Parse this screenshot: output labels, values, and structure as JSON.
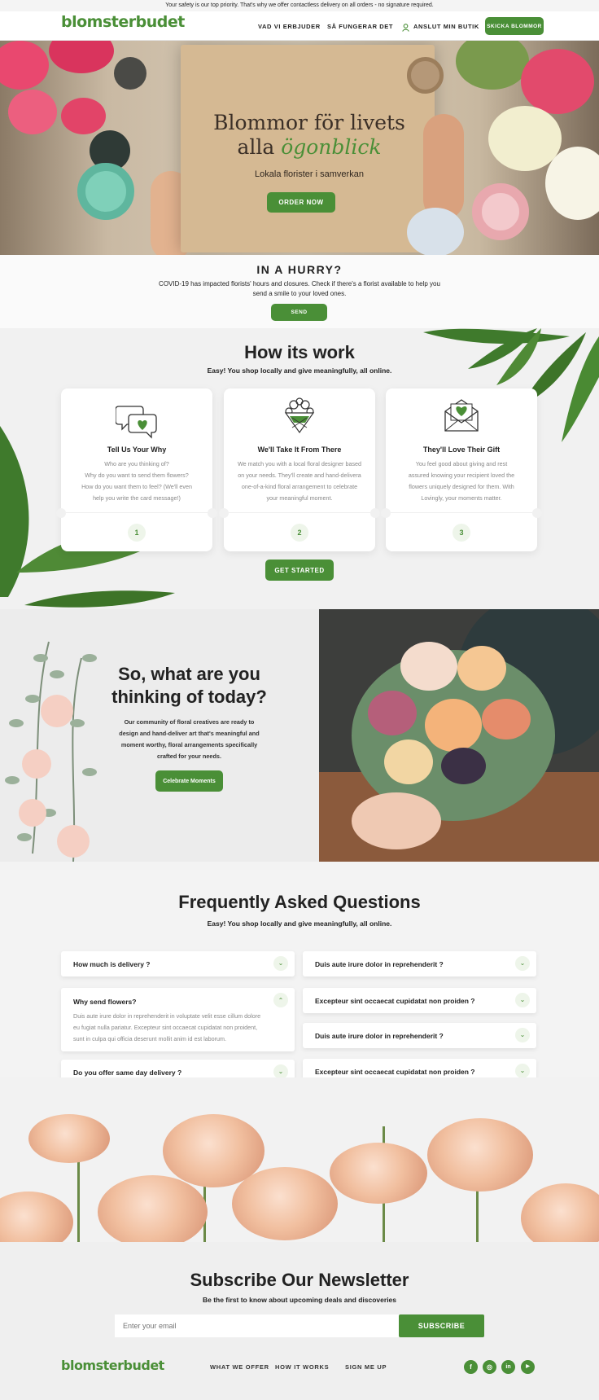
{
  "topbar": {
    "text": "Your safety is our top priority. That's why we offer contactless delivery on all orders - no signature required."
  },
  "header": {
    "logo": "blomsterbudet",
    "nav": [
      "VAD VI ERBJUDER",
      "SÅ FUNGERAR DET"
    ],
    "account": "ANSLUT MIN BUTIK",
    "cta": "SKICKA BLOMMOR"
  },
  "hero": {
    "title_line1": "Blommor för livets",
    "title_line2_a": "alla",
    "title_line2_b": "ögonblick",
    "subtitle": "Lokala florister i samverkan",
    "button": "ORDER NOW"
  },
  "hurry": {
    "title": "IN A HURRY?",
    "text_line1": "COVID-19 has impacted florists' hours and closures. Check if there's a florist available to help you",
    "text_line2": "send a smile to your loved ones.",
    "button": "SEND"
  },
  "how": {
    "title": "How its work",
    "subtitle": "Easy! You shop locally and give meaningfully, all online.",
    "cards": [
      {
        "icon": "chat-heart-icon",
        "title": "Tell Us Your Why",
        "lines": [
          "Who are you thinking of?",
          "Why do you want to send them flowers?",
          "How do you want them to feel? (We'll even",
          "help you write the card message!)"
        ],
        "number": "1"
      },
      {
        "icon": "bouquet-icon",
        "title": "We'll Take It From There",
        "lines": [
          "We match you with a local floral designer based",
          "on your needs. They'll create and hand-delivera",
          "one-of-a-kind floral arrangement to celebrate",
          "your meaningful moment."
        ],
        "number": "2"
      },
      {
        "icon": "envelope-heart-icon",
        "title": "They'll Love Their Gift",
        "lines": [
          "You feel good about giving and rest",
          "assured knowing your recipient loved the",
          "flowers uniquely designed for them. With",
          "Lovingly, your moments matter."
        ],
        "number": "3"
      }
    ],
    "button": "GET STARTED"
  },
  "think": {
    "title_line1": "So, what are you",
    "title_line2": "thinking of today?",
    "lines": [
      "Our community of floral creatives are ready to",
      "design and hand-deliver art that's meaningful and",
      "moment worthy, floral arrangements specifically",
      "crafted for your needs."
    ],
    "button": "Celebrate Moments"
  },
  "faq": {
    "title": "Frequently Asked Questions",
    "subtitle": "Easy! You shop locally and give meaningfully, all online.",
    "left": [
      {
        "q": "How much is delivery ?"
      },
      {
        "q": "Why send flowers?",
        "a_lines": [
          "Duis aute irure dolor in reprehenderit in voluptate velit esse cillum dolore",
          "eu fugiat nulla pariatur. Excepteur sint occaecat cupidatat non proident,",
          "sunt in culpa qui officia deserunt mollit anim id est laborum."
        ]
      },
      {
        "q": "Do you offer same day delivery ?"
      }
    ],
    "right": [
      {
        "q": "Duis aute irure dolor in reprehenderit  ?"
      },
      {
        "q": "Excepteur sint occaecat cupidatat non proiden ?"
      },
      {
        "q": "Duis aute irure dolor in reprehenderit  ?"
      },
      {
        "q": "Excepteur sint occaecat cupidatat non proiden ?"
      }
    ]
  },
  "newsletter": {
    "title": "Subscribe Our Newsletter",
    "subtitle": "Be the first to know about upcoming deals and discoveries",
    "placeholder": "Enter your email",
    "button": "SUBSCRIBE"
  },
  "footer": {
    "logo": "blomsterbudet",
    "nav": [
      "WHAT WE OFFER",
      "HOW IT WORKS",
      "SIGN ME UP"
    ],
    "social": [
      {
        "icon": "facebook-icon",
        "glyph": "f"
      },
      {
        "icon": "instagram-icon",
        "glyph": "◎"
      },
      {
        "icon": "linkedin-icon",
        "glyph": "in"
      },
      {
        "icon": "youtube-icon",
        "glyph": "▶"
      }
    ]
  },
  "colors": {
    "brand_green": "#4a8f37"
  }
}
